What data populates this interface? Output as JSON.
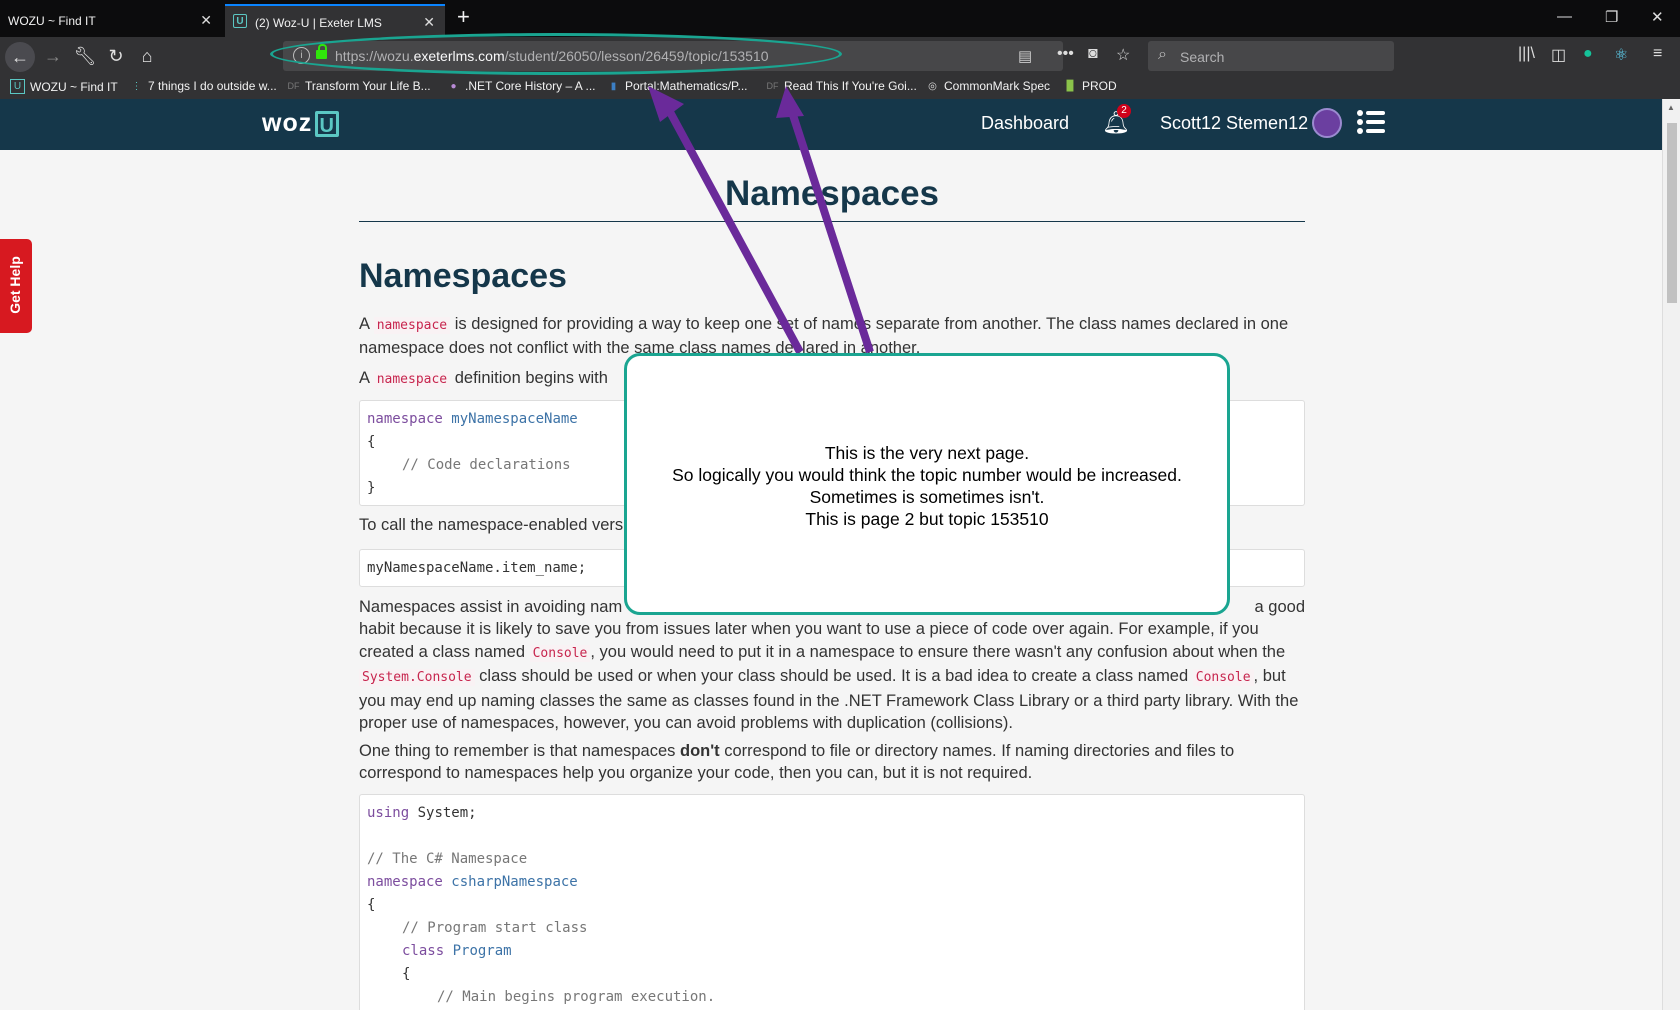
{
  "browser": {
    "tabs": [
      {
        "title": "WOZU ~ Find IT",
        "close": "✕"
      },
      {
        "title": "(2) Woz-U | Exeter LMS",
        "close": "✕"
      }
    ],
    "new_tab": "+",
    "window_controls": {
      "minimize": "—",
      "restore": "❐",
      "close": "✕"
    },
    "url": {
      "prefix": "https://wozu.",
      "domain": "exeterlms.com",
      "path": "/student/26050/lesson/26459/topic/153510"
    },
    "search_placeholder": "Search",
    "bookmarks": [
      {
        "label": "WOZU ~ Find IT",
        "icon": "U"
      },
      {
        "label": "7 things I do outside w...",
        "icon": "⋮"
      },
      {
        "label": "Transform Your Life B...",
        "icon": "DF"
      },
      {
        "label": ".NET Core History – A ...",
        "icon": "●"
      },
      {
        "label": "Portal:Mathematics/P...",
        "icon": "▮"
      },
      {
        "label": "Read This If You're Goi...",
        "icon": "DF"
      },
      {
        "label": "CommonMark Spec",
        "icon": "◎"
      },
      {
        "label": "PROD",
        "icon": "▉"
      }
    ]
  },
  "site": {
    "logo_text": "woz",
    "logo_u": "U",
    "nav_dashboard": "Dashboard",
    "notification_count": "2",
    "user_name": "Scott12 Stemen12",
    "get_help": "Get Help"
  },
  "article": {
    "page_title": "Namespaces",
    "heading": "Namespaces",
    "p1_a": "A ",
    "p1_code": "namespace",
    "p1_b": " is designed for providing a way to keep one set of names separate from another. The class names declared in one namespace does not conflict with the same class names declared in another.",
    "p2_a": "A ",
    "p2_code": "namespace",
    "p2_b": " definition begins with",
    "code1": [
      "namespace",
      "myNamespaceName",
      "{",
      "// Code declarations",
      "}"
    ],
    "p3": "To call the namespace-enabled vers",
    "code2": "myNamespaceName.item_name;",
    "p4_a": "Namespaces assist in avoiding nam",
    "p4_end": "a good",
    "p4_b": "habit because it is likely to save you from issues later when you want to use a piece of code over again. For example, if you created a class named ",
    "p4_code1": "Console",
    "p4_c": ", you would need to put it in a namespace to ensure there wasn't any confusion about when the ",
    "p4_code2": "System.Console",
    "p4_d": " class should be used or when your class should be used. It is a bad idea to create a class named ",
    "p4_code3": "Console",
    "p4_e": ", but you may end up naming classes the same as classes found in the .NET Framework Class Library or a third party library. With the proper use of namespaces, however, you can avoid problems with duplication (collisions).",
    "p5_a": "One thing to remember is that namespaces ",
    "p5_bold": "don't",
    "p5_b": " correspond to file or directory names. If naming directories and files to correspond to namespaces help you organize your code, then you can, but it is not required.",
    "code3": {
      "l1_kw": "using",
      "l1_rest": " System;",
      "l2": "// The C# Namespace",
      "l3_kw": "namespace",
      "l3_type": "csharpNamespace",
      "l4": "{",
      "l5": "// Program start class",
      "l6_kw": "class",
      "l6_type": "Program",
      "l7": "{",
      "l8": "// Main begins program execution."
    }
  },
  "annotation": {
    "lines": [
      "This is the very next page.",
      "So logically you would think the topic number would be increased.",
      "Sometimes is sometimes isn't.",
      "This is page 2 but topic 153510"
    ],
    "colors": {
      "box_border": "#1aa591",
      "arrow": "#6a2a9a"
    }
  }
}
